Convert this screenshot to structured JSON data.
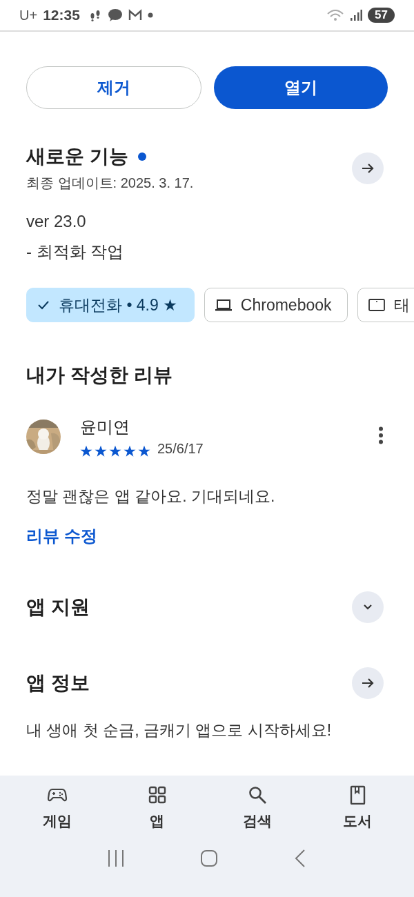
{
  "status_bar": {
    "carrier": "U+",
    "time": "12:35",
    "battery": "57"
  },
  "actions": [
    {
      "label": "제거",
      "kind": "outline"
    },
    {
      "label": "열기",
      "kind": "filled"
    }
  ],
  "whats_new": {
    "title": "새로운 기능",
    "unread": true,
    "updated": "최종 업데이트: 2025. 3. 17.",
    "lines": [
      "ver 23.0",
      "- 최적화 작업"
    ]
  },
  "devices": [
    {
      "label": "휴대전화 • 4.9 ★",
      "selected": true
    },
    {
      "label": "Chromebook",
      "kind": "laptop",
      "selected": false
    },
    {
      "label": "태",
      "kind": "tablet",
      "selected": false
    }
  ],
  "my_review": {
    "title": "내가 작성한 리뷰",
    "author": "윤미연",
    "stars": 5,
    "date": "25/6/17",
    "text": "정말 괜찮은 앱 같아요. 기대되네요.",
    "edit_link": "리뷰 수정"
  },
  "sections": [
    {
      "title": "앱 지원",
      "kind": "expand"
    },
    {
      "title": "앱 정보",
      "kind": "arrow",
      "description": "내 생애 첫 순금, 금캐기 앱으로 시작하세요!"
    }
  ],
  "bottom_nav": [
    {
      "label": "게임",
      "kind": "games"
    },
    {
      "label": "앱",
      "kind": "apps"
    },
    {
      "label": "검색",
      "kind": "search"
    },
    {
      "label": "도서",
      "kind": "books"
    }
  ]
}
